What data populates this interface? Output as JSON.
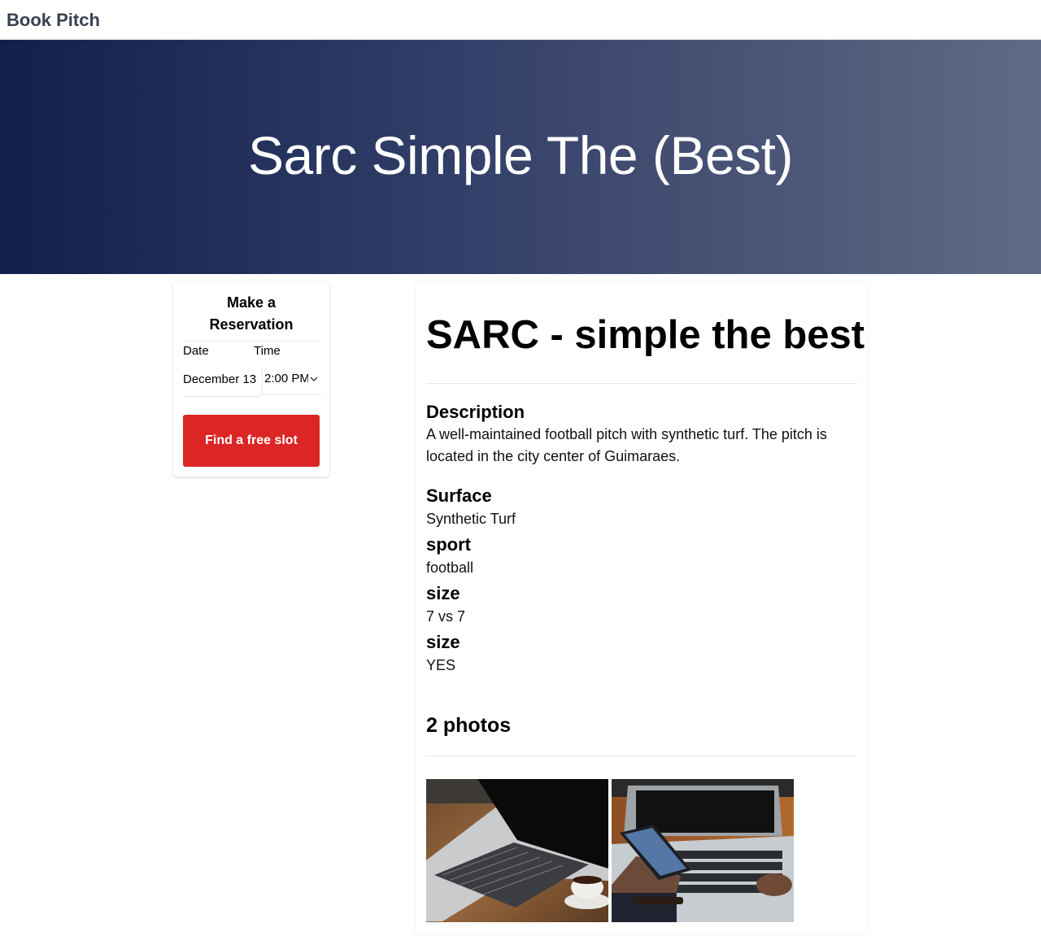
{
  "nav": {
    "brand": "Book Pitch"
  },
  "hero": {
    "title": "Sarc Simple The (Best)"
  },
  "reservation": {
    "title": "Make a Reservation",
    "date_label": "Date",
    "time_label": "Time",
    "date_value": "December 13",
    "time_value": "2:00 PM",
    "button_label": "Find a free slot",
    "button_color": "#dc2626"
  },
  "pitch": {
    "name": "SARC - simple the best",
    "sections": [
      {
        "heading": "Description",
        "value": "A well-maintained football pitch with synthetic turf. The pitch is located in the city center of Guimaraes."
      },
      {
        "heading": "Surface",
        "value": "Synthetic Turf"
      },
      {
        "heading": "sport",
        "value": "football"
      },
      {
        "heading": "size",
        "value": "7 vs 7"
      },
      {
        "heading": "size",
        "value": "YES"
      }
    ],
    "photos_title": "2 photos"
  },
  "hero_gradient": [
    "#111f4b",
    "#616b86"
  ]
}
